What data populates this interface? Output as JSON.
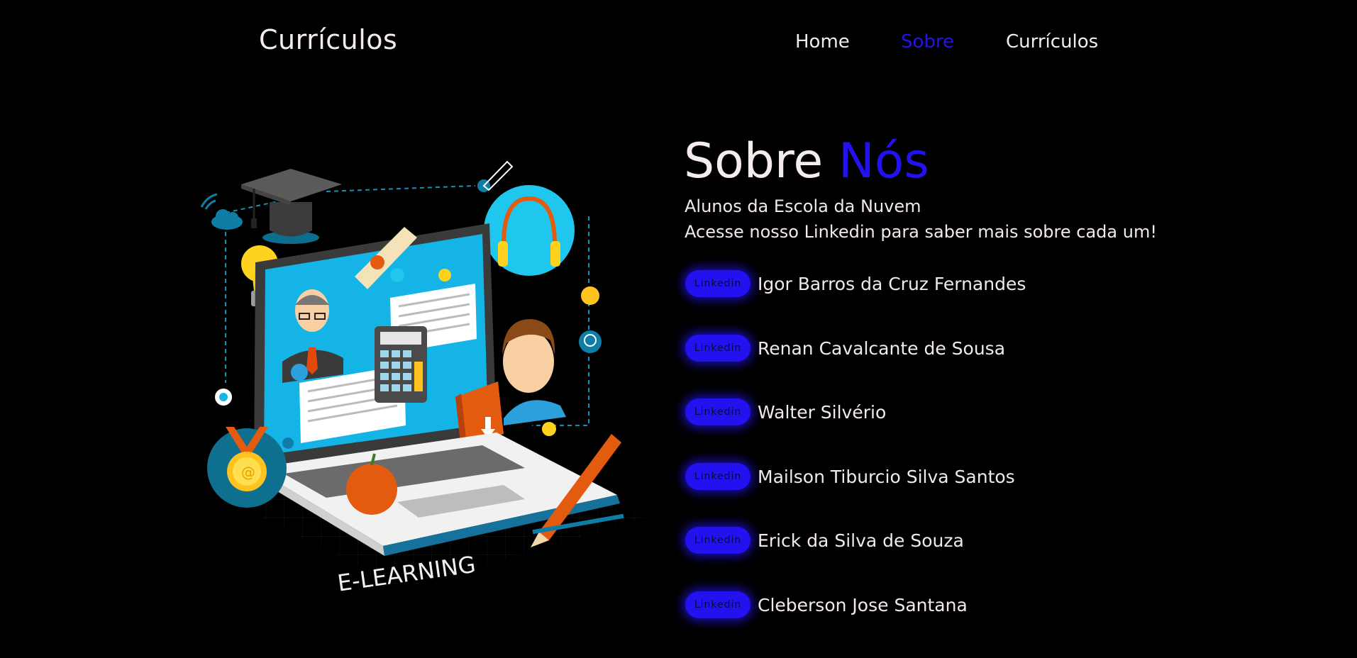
{
  "header": {
    "brand": "Currículos",
    "nav": {
      "home": "Home",
      "sobre": "Sobre",
      "curriculos": "Currículos"
    }
  },
  "about": {
    "title_main": "Sobre",
    "title_accent": "Nós",
    "line1": "Alunos da Escola da Nuvem",
    "line2": "Acesse nosso Linkedin para saber mais sobre cada um!"
  },
  "illustration": {
    "caption": "E-LEARNING"
  },
  "members": [
    {
      "badge": "Linkedin",
      "name": "Igor Barros da Cruz Fernandes"
    },
    {
      "badge": "Linkedin",
      "name": "Renan Cavalcante de Sousa"
    },
    {
      "badge": "Linkedin",
      "name": "Walter Silvério"
    },
    {
      "badge": "Linkedin",
      "name": "Mailson Tiburcio Silva Santos"
    },
    {
      "badge": "Linkedin",
      "name": "Erick da Silva de Souza"
    },
    {
      "badge": "Linkedin",
      "name": "Cleberson Jose Santana"
    }
  ],
  "colors": {
    "accent": "#2411f0",
    "background": "#000000",
    "text": "#f1e9ea"
  }
}
